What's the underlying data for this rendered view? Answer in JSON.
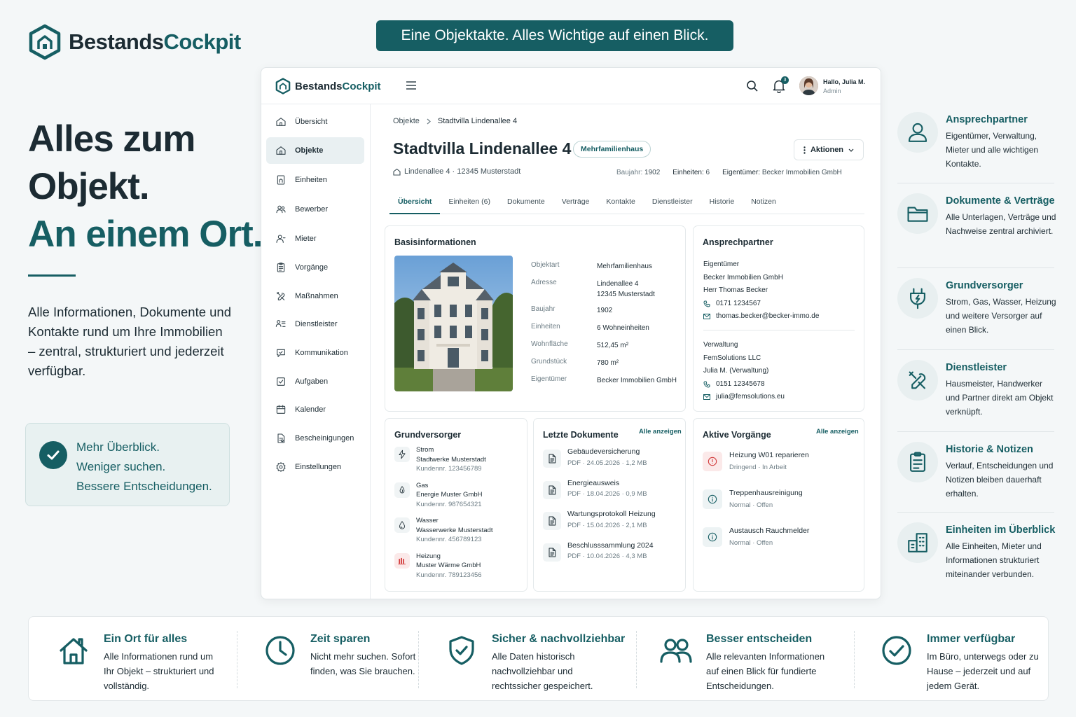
{
  "brand": {
    "part1": "Bestands",
    "part2": "Cockpit",
    "accent_color": "#165e63"
  },
  "banner": "Eine Objektakte. Alles Wichtige auf einen Blick.",
  "hero": {
    "line1": "Alles zum",
    "line2": "Objekt.",
    "line3": "An einem Ort.",
    "text": "Alle Informationen, Dokumente und Kontakte rund um Ihre Immobilien – zentral, strukturiert und jederzeit verfügbar."
  },
  "callout": {
    "line1": "Mehr Überblick.",
    "line2": "Weniger suchen.",
    "line3": "Bessere Entscheidungen.",
    "icon": "check-icon"
  },
  "app": {
    "header": {
      "notifications": "3",
      "greeting": "Hallo, Julia M.",
      "role": "Admin"
    },
    "nav": [
      {
        "label": "Übersicht",
        "icon": "home-icon"
      },
      {
        "label": "Objekte",
        "icon": "building-icon"
      },
      {
        "label": "Einheiten",
        "icon": "unit-icon"
      },
      {
        "label": "Bewerber",
        "icon": "users-icon"
      },
      {
        "label": "Mieter",
        "icon": "tenant-icon"
      },
      {
        "label": "Vorgänge",
        "icon": "clipboard-icon"
      },
      {
        "label": "Maßnahmen",
        "icon": "tools-icon"
      },
      {
        "label": "Dienstleister",
        "icon": "provider-icon"
      },
      {
        "label": "Kommunikation",
        "icon": "chat-icon"
      },
      {
        "label": "Aufgaben",
        "icon": "task-icon"
      },
      {
        "label": "Kalender",
        "icon": "calendar-icon"
      },
      {
        "label": "Bescheinigungen",
        "icon": "certificate-icon"
      },
      {
        "label": "Einstellungen",
        "icon": "gear-icon"
      }
    ],
    "breadcrumb": {
      "root": "Objekte",
      "current": "Stadtvilla Lindenallee 4"
    },
    "title": "Stadtvilla Lindenallee 4",
    "type_pill": "Mehrfamilienhaus",
    "actions_label": "Aktionen",
    "address": "Lindenallee 4 · 12345 Musterstadt",
    "meta": {
      "baujahr_label": "Baujahr:",
      "baujahr": "1902",
      "einheiten_label": "Einheiten:",
      "einheiten": "6",
      "eigentuemer_label": "Eigentümer:",
      "eigentuemer": "Becker Immobilien GmbH"
    },
    "tabs": [
      "Übersicht",
      "Einheiten (6)",
      "Dokumente",
      "Verträge",
      "Kontakte",
      "Dienstleister",
      "Historie",
      "Notizen"
    ],
    "basis": {
      "title": "Basisinformationen",
      "rows": [
        {
          "k": "Objektart",
          "v": "Mehrfamilienhaus"
        },
        {
          "k": "Adresse",
          "v": "Lindenallee 4",
          "v2": "12345 Musterstadt"
        },
        {
          "k": "Baujahr",
          "v": "1902"
        },
        {
          "k": "Einheiten",
          "v": "6 Wohneinheiten"
        },
        {
          "k": "Wohnfläche",
          "v": "512,45 m²"
        },
        {
          "k": "Grundstück",
          "v": "780 m²"
        },
        {
          "k": "Eigentümer",
          "v": "Becker Immobilien GmbH"
        }
      ]
    },
    "contacts": {
      "title": "Ansprechpartner",
      "owner": {
        "role": "Eigentümer",
        "company": "Becker Immobilien GmbH",
        "person": "Herr Thomas Becker",
        "phone": "0171 1234567",
        "email": "thomas.becker@becker-immo.de"
      },
      "admin": {
        "role": "Verwaltung",
        "company": "FemSolutions LLC",
        "person": "Julia M. (Verwaltung)",
        "phone": "0151 12345678",
        "email": "julia@femsolutions.eu"
      }
    },
    "suppliers": {
      "title": "Grundversorger",
      "items": [
        {
          "type": "Strom",
          "name": "Stadtwerke Musterstadt",
          "no": "Kundennr. 123456789",
          "icon": "lightning-icon"
        },
        {
          "type": "Gas",
          "name": "Energie Muster GmbH",
          "no": "Kundennr. 987654321",
          "icon": "flame-icon"
        },
        {
          "type": "Wasser",
          "name": "Wasserwerke Musterstadt",
          "no": "Kundennr. 456789123",
          "icon": "water-drop-icon"
        },
        {
          "type": "Heizung",
          "name": "Muster Wärme GmbH",
          "no": "Kundennr. 789123456",
          "icon": "heater-icon"
        }
      ]
    },
    "documents": {
      "title": "Letzte Dokumente",
      "link": "Alle anzeigen",
      "items": [
        {
          "name": "Gebäudeversicherung",
          "meta": "PDF · 24.05.2026 · 1,2 MB"
        },
        {
          "name": "Energieausweis",
          "meta": "PDF · 18.04.2026 · 0,9 MB"
        },
        {
          "name": "Wartungsprotokoll Heizung",
          "meta": "PDF · 15.04.2026 · 2,1 MB"
        },
        {
          "name": "Beschlusssammlung 2024",
          "meta": "PDF · 10.04.2026 · 4,3 MB"
        }
      ]
    },
    "processes": {
      "title": "Aktive Vorgänge",
      "link": "Alle anzeigen",
      "items": [
        {
          "name": "Heizung W01 reparieren",
          "meta": "Dringend · In Arbeit",
          "urgent": true
        },
        {
          "name": "Treppenhausreinigung",
          "meta": "Normal · Offen",
          "urgent": false
        },
        {
          "name": "Austausch Rauchmelder",
          "meta": "Normal · Offen",
          "urgent": false
        }
      ]
    }
  },
  "features": [
    {
      "title": "Ansprechpartner",
      "desc": "Eigentümer, Verwaltung, Mieter und alle wichtigen Kontakte.",
      "icon": "person-icon"
    },
    {
      "title": "Dokumente & Verträge",
      "desc": "Alle Unterlagen, Verträge und Nachweise zentral archiviert.",
      "icon": "folder-icon"
    },
    {
      "title": "Grundversorger",
      "desc": "Strom, Gas, Wasser, Heizung und weitere Versorger auf einen Blick.",
      "icon": "plug-icon"
    },
    {
      "title": "Dienstleister",
      "desc": "Hausmeister, Handwerker und Partner direkt am Objekt verknüpft.",
      "icon": "tools-icon"
    },
    {
      "title": "Historie & Notizen",
      "desc": "Verlauf, Entscheidungen und Notizen bleiben dauerhaft erhalten.",
      "icon": "clipboard-icon"
    },
    {
      "title": "Einheiten im Überblick",
      "desc": "Alle Einheiten, Mieter und Informationen strukturiert miteinander verbunden.",
      "icon": "buildings-icon"
    }
  ],
  "benefits": [
    {
      "title": "Ein Ort für alles",
      "desc": "Alle Informationen rund um Ihr Objekt – strukturiert und vollständig.",
      "icon": "house-icon"
    },
    {
      "title": "Zeit sparen",
      "desc": "Nicht mehr suchen. Sofort finden, was Sie brauchen.",
      "icon": "clock-icon"
    },
    {
      "title": "Sicher & nachvollziehbar",
      "desc": "Alle Daten historisch nachvollziehbar und rechtssicher gespeichert.",
      "icon": "shield-check-icon"
    },
    {
      "title": "Besser entscheiden",
      "desc": "Alle relevanten Informationen auf einen Blick für fundierte Entscheidungen.",
      "icon": "people-icon"
    },
    {
      "title": "Immer verfügbar",
      "desc": "Im Büro, unterwegs oder zu Hause – jederzeit und auf jedem Gerät.",
      "icon": "check-circle-icon"
    }
  ]
}
